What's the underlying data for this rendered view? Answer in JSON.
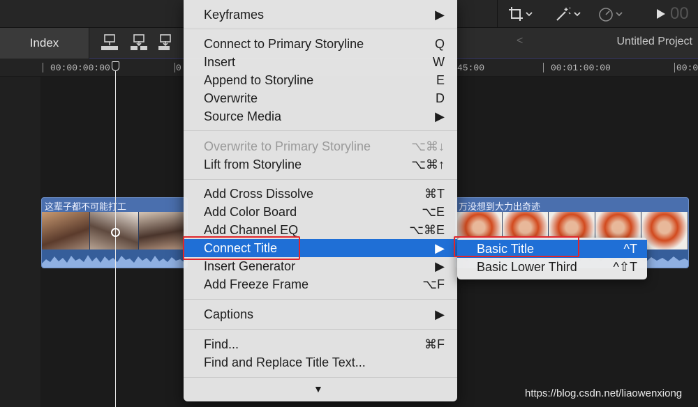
{
  "toolbar": {
    "crop_icon": "crop-icon",
    "transform_icon": "magic-wand-icon",
    "speed_icon": "speedometer-icon",
    "play_icon": "play-icon",
    "timecode_partial": "00"
  },
  "secondary_bar": {
    "index_label": "Index",
    "back_icon": "chevron-left-icon",
    "project_title": "Untitled Project"
  },
  "ruler": {
    "timecodes": [
      "00:00:00:00",
      "0",
      "45:00",
      "00:01:00:00",
      "00:0"
    ]
  },
  "clips": [
    {
      "title": "这辈子都不可能打工"
    },
    {
      "title": "万没想到大力出奇迹"
    }
  ],
  "menu": {
    "items": [
      {
        "label": "Keyframes",
        "shortcut": "▶"
      },
      {
        "label": "Connect to Primary Storyline",
        "shortcut": "Q"
      },
      {
        "label": "Insert",
        "shortcut": "W"
      },
      {
        "label": "Append to Storyline",
        "shortcut": "E"
      },
      {
        "label": "Overwrite",
        "shortcut": "D"
      },
      {
        "label": "Source Media",
        "shortcut": "▶"
      },
      {
        "label": "Overwrite to Primary Storyline",
        "shortcut": "⌥⌘↓"
      },
      {
        "label": "Lift from Storyline",
        "shortcut": "⌥⌘↑"
      },
      {
        "label": "Add Cross Dissolve",
        "shortcut": "⌘T"
      },
      {
        "label": "Add Color Board",
        "shortcut": "⌥E"
      },
      {
        "label": "Add Channel EQ",
        "shortcut": "⌥⌘E"
      },
      {
        "label": "Connect Title",
        "shortcut": "▶"
      },
      {
        "label": "Insert Generator",
        "shortcut": "▶"
      },
      {
        "label": "Add Freeze Frame",
        "shortcut": "⌥F"
      },
      {
        "label": "Captions",
        "shortcut": "▶"
      },
      {
        "label": "Find...",
        "shortcut": "⌘F"
      },
      {
        "label": "Find and Replace Title Text...",
        "shortcut": ""
      }
    ],
    "scroll_indicator": "▼"
  },
  "submenu": {
    "items": [
      {
        "label": "Basic Title",
        "shortcut": "^T"
      },
      {
        "label": "Basic Lower Third",
        "shortcut": "^⇧T"
      }
    ]
  },
  "colors": {
    "highlight": "#1f6fd6",
    "annotation": "#e0252b",
    "clip": "#4a6fae"
  },
  "watermark": "https://blog.csdn.net/liaowenxiong"
}
